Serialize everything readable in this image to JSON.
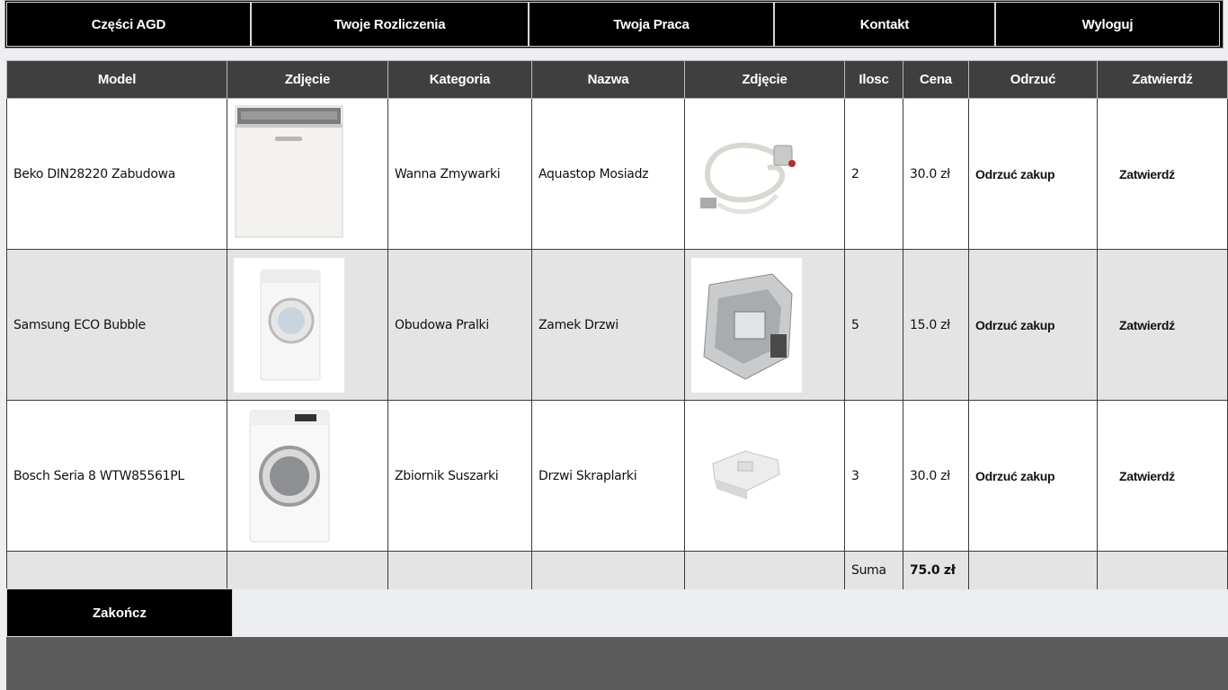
{
  "nav": {
    "items": [
      {
        "label": "Części AGD",
        "name": "nav-czesci-agd"
      },
      {
        "label": "Twoje Rozliczenia",
        "name": "nav-twoje-rozliczenia"
      },
      {
        "label": "Twoja Praca",
        "name": "nav-twoja-praca"
      },
      {
        "label": "Kontakt",
        "name": "nav-kontakt"
      },
      {
        "label": "Wyloguj",
        "name": "nav-wyloguj"
      }
    ]
  },
  "table": {
    "headers": [
      "Model",
      "Zdjęcie",
      "Kategoria",
      "Nazwa",
      "Zdjęcie",
      "Ilosc",
      "Cena",
      "Odrzuć",
      "Zatwierdź"
    ],
    "rows": [
      {
        "model": "Beko DIN28220 Zabudowa",
        "device_icon": "dishwasher-image",
        "category": "Wanna Zmywarki",
        "name": "Aquastop Mosiadz",
        "part_icon": "aquastop-hose-image",
        "qty": "2",
        "price": "30.0 zł",
        "reject": "Odrzuć zakup",
        "approve": "Zatwierdź"
      },
      {
        "model": "Samsung ECO Bubble",
        "device_icon": "washing-machine-image",
        "category": "Obudowa Pralki",
        "name": "Zamek Drzwi",
        "part_icon": "door-lock-image",
        "qty": "5",
        "price": "15.0 zł",
        "reject": "Odrzuć zakup",
        "approve": "Zatwierdź"
      },
      {
        "model": "Bosch Seria 8 WTW85561PL",
        "device_icon": "dryer-image",
        "category": "Zbiornik Suszarki",
        "name": "Drzwi Skraplarki",
        "part_icon": "condenser-door-image",
        "qty": "3",
        "price": "30.0 zł",
        "reject": "Odrzuć zakup",
        "approve": "Zatwierdź"
      }
    ],
    "sum_label": "Suma",
    "sum_value": "75.0 zł"
  },
  "finish_label": "Zakończ",
  "colors": {
    "nav_bg": "#000000",
    "header_bg": "#3f3f3f",
    "alt_row_bg": "#e4e4e4",
    "footer_bg": "#5c5c5c"
  }
}
